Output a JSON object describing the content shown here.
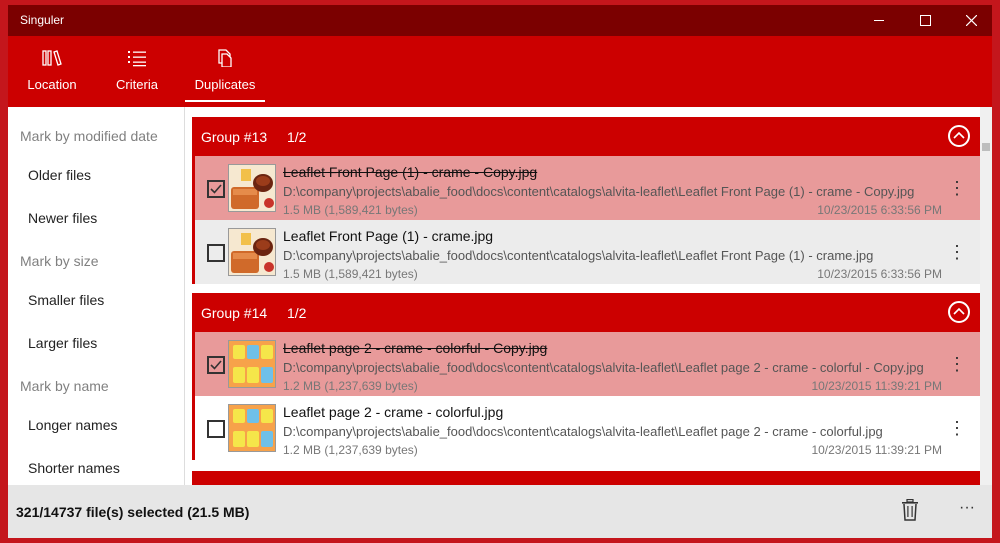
{
  "window": {
    "title": "Singuler",
    "controls": {
      "minimize": "—",
      "maximize": "☐",
      "close": "✕"
    }
  },
  "toolbar": {
    "tabs": [
      {
        "label": "Location",
        "icon": "library-icon"
      },
      {
        "label": "Criteria",
        "icon": "list-icon"
      },
      {
        "label": "Duplicates",
        "icon": "copy-icon",
        "selected": true
      }
    ]
  },
  "sidebar": {
    "sections": [
      {
        "heading": "Mark by modified date",
        "items": [
          "Older files",
          "Newer files"
        ]
      },
      {
        "heading": "Mark by size",
        "items": [
          "Smaller files",
          "Larger files"
        ]
      },
      {
        "heading": "Mark by name",
        "items": [
          "Longer names",
          "Shorter names"
        ]
      }
    ]
  },
  "groups": [
    {
      "name": "Group #13",
      "count": "1/2",
      "files": [
        {
          "name": "Leaflet Front Page (1) - crame - Copy.jpg",
          "path": "D:\\company\\projects\\abalie_food\\docs\\content\\catalogs\\alvita-leaflet\\Leaflet Front Page (1) - crame - Copy.jpg",
          "size": "1.5 MB (1,589,421 bytes)",
          "date": "10/23/2015 6:33:56 PM",
          "marked": true,
          "thumb": "food"
        },
        {
          "name": "Leaflet Front Page (1) - crame.jpg",
          "path": "D:\\company\\projects\\abalie_food\\docs\\content\\catalogs\\alvita-leaflet\\Leaflet Front Page (1) - crame.jpg",
          "size": "1.5 MB (1,589,421 bytes)",
          "date": "10/23/2015 6:33:56 PM",
          "marked": false,
          "thumb": "food"
        }
      ]
    },
    {
      "name": "Group #14",
      "count": "1/2",
      "files": [
        {
          "name": "Leaflet page 2 - crame - colorful - Copy.jpg",
          "path": "D:\\company\\projects\\abalie_food\\docs\\content\\catalogs\\alvita-leaflet\\Leaflet page 2 - crame - colorful - Copy.jpg",
          "size": "1.2 MB (1,237,639 bytes)",
          "date": "10/23/2015 11:39:21 PM",
          "marked": true,
          "thumb": "jars"
        },
        {
          "name": "Leaflet page 2 - crame - colorful.jpg",
          "path": "D:\\company\\projects\\abalie_food\\docs\\content\\catalogs\\alvita-leaflet\\Leaflet page 2 - crame - colorful.jpg",
          "size": "1.2 MB (1,237,639 bytes)",
          "date": "10/23/2015 11:39:21 PM",
          "marked": false,
          "thumb": "jars"
        }
      ]
    }
  ],
  "status": {
    "text": "321/14737 file(s) selected (21.5 MB)",
    "more": "···"
  },
  "colors": {
    "accent": "#cc0000",
    "titlebar": "#7b0000",
    "marked_row": "#e89a9a"
  }
}
